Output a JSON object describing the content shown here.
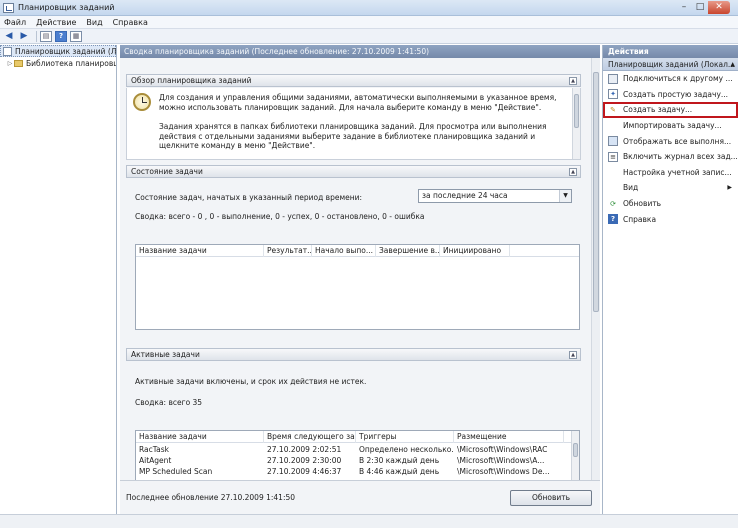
{
  "window": {
    "title": "Планировщик заданий"
  },
  "menu": [
    "Файл",
    "Действие",
    "Вид",
    "Справка"
  ],
  "tree": {
    "root": "Планировщик заданий (Лока",
    "child": "Библиотека планировщ"
  },
  "center": {
    "header": "Сводка планировщика заданий (Последнее обновление: 27.10.2009 1:41:50)",
    "overview": {
      "title": "Обзор планировщика заданий",
      "p1": "Для создания и управления общими заданиями, автоматически выполняемыми в указанное время, можно использовать планировщик заданий. Для начала выберите команду в меню \"Действие\".",
      "p2": "Задания хранятся в папках библиотеки планировщика заданий. Для просмотра или выполнения действия с отдельными заданиями выберите задание в библиотеке планировщика заданий и щелкните команду в меню \"Действие\"."
    },
    "status": {
      "title": "Состояние задачи",
      "period_label": "Состояние задач, начатых в указанный период времени:",
      "period_value": "за последние 24 часа",
      "summary": "Сводка: всего - 0 , 0 - выполнение, 0 - успех, 0 - остановлено, 0 - ошибка",
      "columns": [
        "Название задачи",
        "Результат...",
        "Начало выпо...",
        "Завершение в...",
        "Инициировано"
      ]
    },
    "active": {
      "title": "Активные задачи",
      "note": "Активные задачи включены, и срок их действия не истек.",
      "summary": "Сводка: всего 35",
      "columns": [
        "Название задачи",
        "Время следующего запу...",
        "Триггеры",
        "Размещение"
      ],
      "rows": [
        [
          "RacTask",
          "27.10.2009 2:02:51",
          "Определено несколько...",
          "\\Microsoft\\Windows\\RAC"
        ],
        [
          "AitAgent",
          "27.10.2009 2:30:00",
          "В 2:30 каждый день",
          "\\Microsoft\\Windows\\A..."
        ],
        [
          "MP Scheduled Scan",
          "27.10.2009 4:46:37",
          "В 4:46 каждый день",
          "\\Microsoft\\Windows De..."
        ]
      ]
    },
    "last_update": "Последнее обновление 27.10.2009 1:41:50",
    "refresh_button": "Обновить"
  },
  "actions": {
    "title": "Действия",
    "section": "Планировщик заданий (Локал...",
    "items": [
      {
        "label": "Подключиться к другому ...",
        "icon": "connect-icon"
      },
      {
        "label": "Создать простую задачу...",
        "icon": "wizard-icon"
      },
      {
        "label": "Создать задачу...",
        "icon": "create-task-icon"
      },
      {
        "label": "Импортировать задачу...",
        "icon": "import-icon"
      },
      {
        "label": "Отображать все выполня...",
        "icon": "running-icon"
      },
      {
        "label": "Включить журнал всех зад...",
        "icon": "log-icon"
      },
      {
        "label": "Настройка учетной запис...",
        "icon": ""
      },
      {
        "label": "Вид",
        "icon": ""
      },
      {
        "label": "Обновить",
        "icon": "refresh-icon"
      },
      {
        "label": "Справка",
        "icon": "help-icon"
      }
    ],
    "highlight_color": "#c0161c"
  }
}
